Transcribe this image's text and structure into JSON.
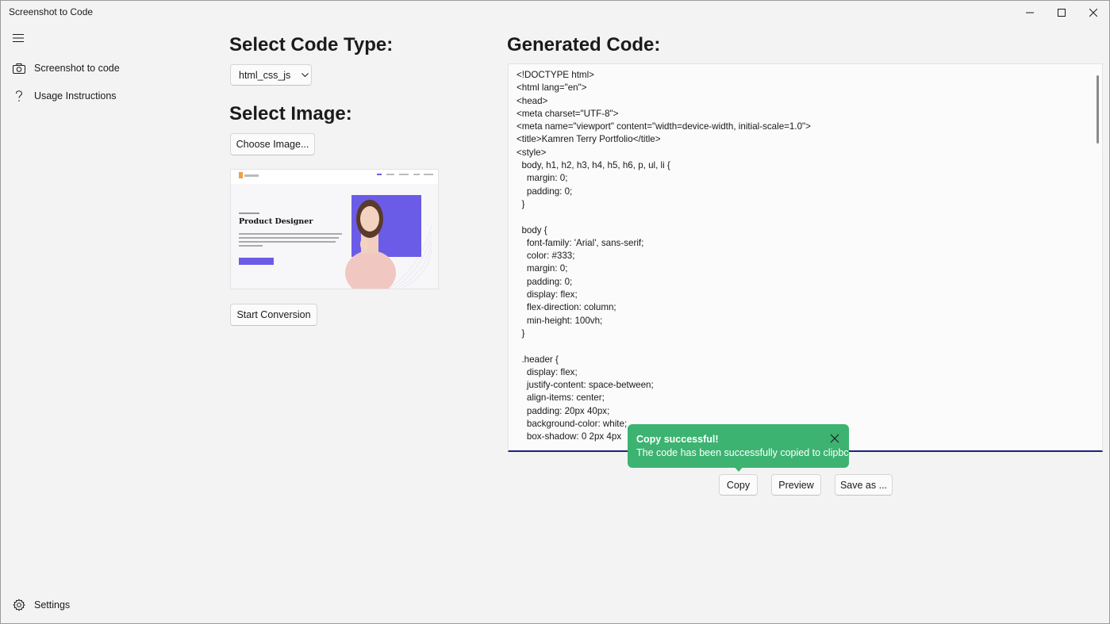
{
  "window": {
    "title": "Screenshot to Code"
  },
  "nav": {
    "items": [
      {
        "label": "Screenshot to code",
        "icon": "camera-icon"
      },
      {
        "label": "Usage Instructions",
        "icon": "question-icon"
      }
    ],
    "settings_label": "Settings"
  },
  "left_panel": {
    "code_type_heading": "Select Code Type:",
    "code_type_selected": "html_css_js",
    "image_heading": "Select Image:",
    "choose_image_label": "Choose Image...",
    "start_conversion_label": "Start Conversion",
    "thumbnail": {
      "headline": "Product Designer"
    }
  },
  "right_panel": {
    "heading": "Generated Code:",
    "code_lines": [
      "<!DOCTYPE html>",
      "<html lang=\"en\">",
      "<head>",
      "<meta charset=\"UTF-8\">",
      "<meta name=\"viewport\" content=\"width=device-width, initial-scale=1.0\">",
      "<title>Kamren Terry Portfolio</title>",
      "<style>",
      "  body, h1, h2, h3, h4, h5, h6, p, ul, li {",
      "    margin: 0;",
      "    padding: 0;",
      "  }",
      "",
      "  body {",
      "    font-family: 'Arial', sans-serif;",
      "    color: #333;",
      "    margin: 0;",
      "    padding: 0;",
      "    display: flex;",
      "    flex-direction: column;",
      "    min-height: 100vh;",
      "  }",
      "",
      "  .header {",
      "    display: flex;",
      "    justify-content: space-between;",
      "    align-items: center;",
      "    padding: 20px 40px;",
      "    background-color: white;",
      "    box-shadow: 0 2px 4px"
    ],
    "copy_label": "Copy",
    "preview_label": "Preview",
    "save_label": "Save as ..."
  },
  "toast": {
    "title": "Copy successful!",
    "message": "The code has been successfully copied to clipbc",
    "color": "#3cb371"
  },
  "colors": {
    "accent_underline": "#1a237e",
    "thumbnail_purple": "#6b5ce7"
  }
}
